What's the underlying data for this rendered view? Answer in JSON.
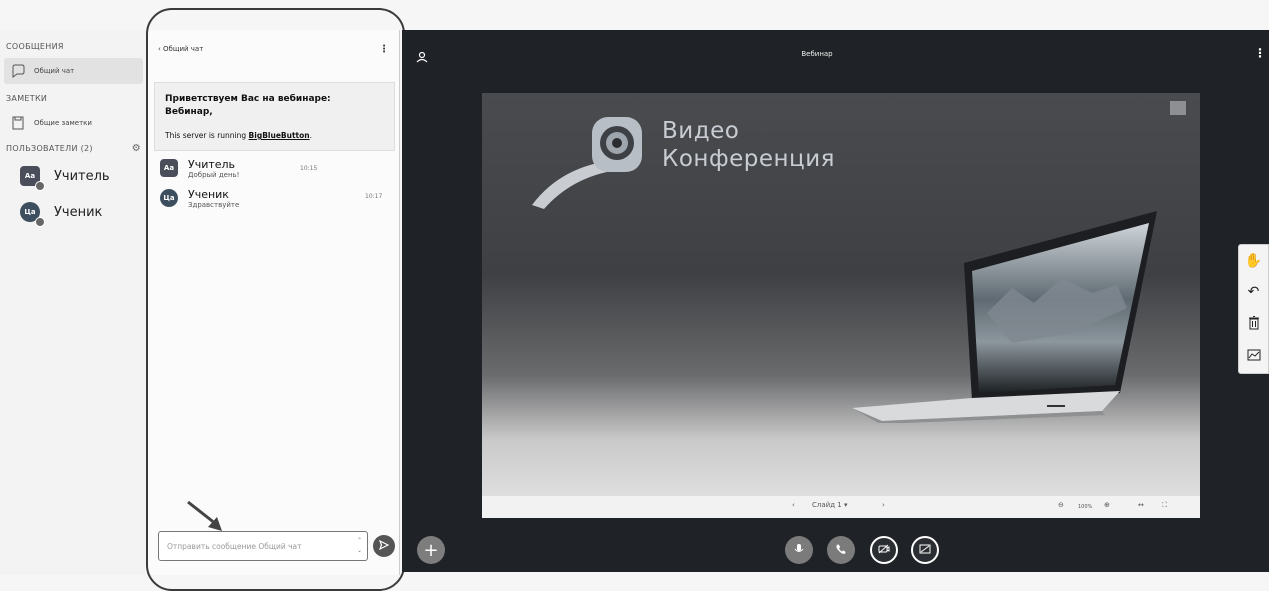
{
  "sidebar": {
    "messages_title": "СООБЩЕНИЯ",
    "public_chat_label": "Общий чат",
    "notes_title": "ЗАМЕТКИ",
    "shared_notes_label": "Общие заметки",
    "users_title": "ПОЛЬЗОВАТЕЛИ (2)",
    "users": [
      {
        "initials": "Аа",
        "name": "Учитель",
        "avatar": "square"
      },
      {
        "initials": "Ца",
        "name": "Ученик",
        "avatar": "round"
      }
    ]
  },
  "chat": {
    "back_label": "Общий чат",
    "welcome_line1": "Приветствуем Вас на вебинаре:",
    "welcome_line2": "Вебинар,",
    "server_prefix": "This server is running ",
    "server_link": "BigBlueButton",
    "server_suffix": ".",
    "messages": [
      {
        "initials": "Аа",
        "name": "Учитель",
        "text": "Добрый день!",
        "time": "10:15"
      },
      {
        "initials": "Ца",
        "name": "Ученик",
        "text": "Здравствуйте",
        "time": "10:17"
      }
    ],
    "input_placeholder": "Отправить сообщение Общий чат"
  },
  "stage": {
    "title": "Вебинар",
    "logo_line1": "Видео",
    "logo_line2": "Конференция",
    "slide_label": "Слайд 1",
    "zoom": "100%"
  },
  "colors": {
    "stage_bg": "#1f2226",
    "chat_bg": "#fbfbfb",
    "sidebar_bg": "#f3f3f3"
  }
}
